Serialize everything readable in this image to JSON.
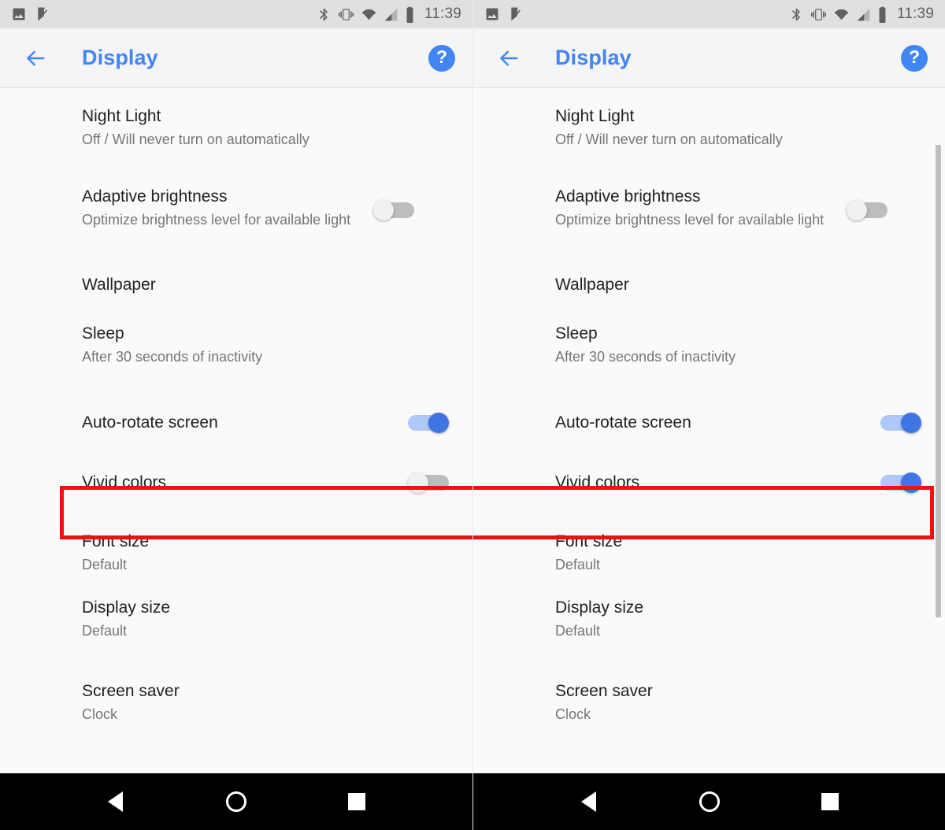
{
  "status_bar": {
    "icons_left": [
      "image-icon",
      "checkmark-flag-icon"
    ],
    "icons_right": [
      "bluetooth-icon",
      "vibrate-icon",
      "wifi-icon",
      "cellular-signal-icon",
      "battery-icon"
    ],
    "time": "11:39"
  },
  "app_bar": {
    "back_icon": "arrow-left-icon",
    "title": "Display",
    "help_icon": "help-question-icon",
    "help_glyph": "?",
    "accent_color": "#4285f4"
  },
  "settings": {
    "rows": [
      {
        "title": "Night Light",
        "subtitle": "Off / Will never turn on automatically",
        "control": "none"
      },
      {
        "title": "Adaptive brightness",
        "subtitle": "Optimize brightness level for available light",
        "control": "switch"
      },
      {
        "title": "Wallpaper",
        "subtitle": "",
        "control": "none"
      },
      {
        "title": "Sleep",
        "subtitle": "After 30 seconds of inactivity",
        "control": "none"
      },
      {
        "title": "Auto-rotate screen",
        "subtitle": "",
        "control": "switch"
      },
      {
        "title": "Vivid colors",
        "subtitle": "",
        "control": "switch"
      },
      {
        "title": "Font size",
        "subtitle": "Default",
        "control": "none"
      },
      {
        "title": "Display size",
        "subtitle": "Default",
        "control": "none"
      },
      {
        "title": "Screen saver",
        "subtitle": "Clock",
        "control": "none"
      }
    ]
  },
  "panels": {
    "left": {
      "switch_states": {
        "adaptive_brightness": "off",
        "auto_rotate_screen": "on",
        "vivid_colors": "off"
      },
      "scrollbar_visible": false
    },
    "right": {
      "switch_states": {
        "adaptive_brightness": "off",
        "auto_rotate_screen": "on",
        "vivid_colors": "on"
      },
      "scrollbar_visible": true
    }
  },
  "annotation": {
    "highlight_color": "#ee1111",
    "highlighted_row": "Vivid colors"
  },
  "nav_bar": {
    "back_label": "back-triangle-icon",
    "home_label": "home-circle-icon",
    "recents_label": "recents-square-icon"
  }
}
